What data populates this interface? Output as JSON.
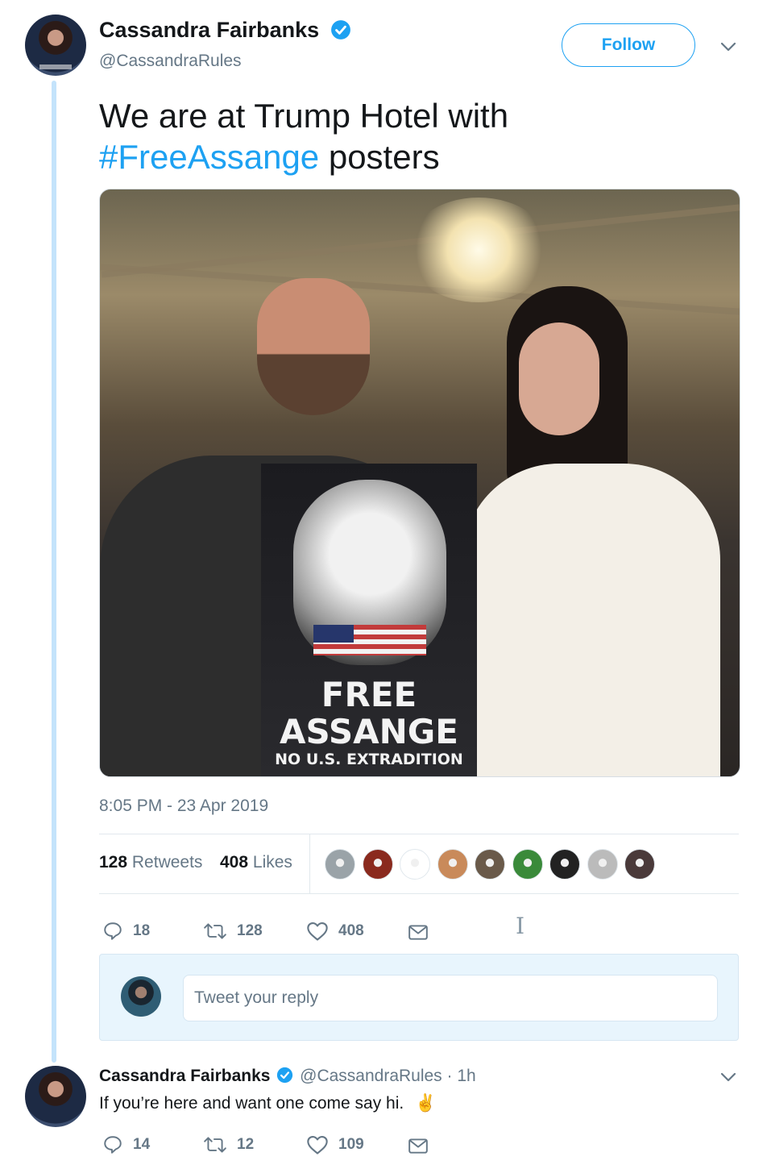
{
  "tweet": {
    "author_name": "Cassandra Fairbanks",
    "handle": "@CassandraRules",
    "follow_label": "Follow",
    "text_before": "We are at Trump Hotel with",
    "hashtag": "#FreeAssange",
    "text_after": " posters",
    "photo": {
      "poster_line_1": "FREE",
      "poster_line_2": "ASSANGE",
      "poster_line_3": "NO U.S. EXTRADITION"
    },
    "timestamp": "8:05 PM - 23 Apr 2019",
    "stats": {
      "retweets_count": "128",
      "retweets_label": "Retweets",
      "likes_count": "408",
      "likes_label": "Likes"
    },
    "likers": [
      {
        "name": "liker-1",
        "color": "#9aa3a8"
      },
      {
        "name": "liker-2",
        "color": "#8a2a1e"
      },
      {
        "name": "liker-3",
        "color": "#ffffff"
      },
      {
        "name": "liker-4",
        "color": "#c98a5a"
      },
      {
        "name": "liker-5",
        "color": "#6a5a4a"
      },
      {
        "name": "liker-6",
        "color": "#3a8a3a"
      },
      {
        "name": "liker-7",
        "color": "#222222"
      },
      {
        "name": "liker-8",
        "color": "#bbbbbb"
      },
      {
        "name": "liker-9",
        "color": "#4a3a3a"
      }
    ],
    "actions": {
      "replies": "18",
      "retweets": "128",
      "likes": "408"
    }
  },
  "reply_box": {
    "placeholder": "Tweet your reply"
  },
  "reply_tweet": {
    "author_name": "Cassandra Fairbanks",
    "handle": "@CassandraRules",
    "time": "· 1h",
    "text": "If you’re here and want one come say hi.",
    "emoji": "✌️",
    "actions": {
      "replies": "14",
      "retweets": "12",
      "likes": "109"
    }
  },
  "colors": {
    "accent": "#1da1f2",
    "muted": "#657786",
    "thread_line": "#c4e3fb"
  }
}
